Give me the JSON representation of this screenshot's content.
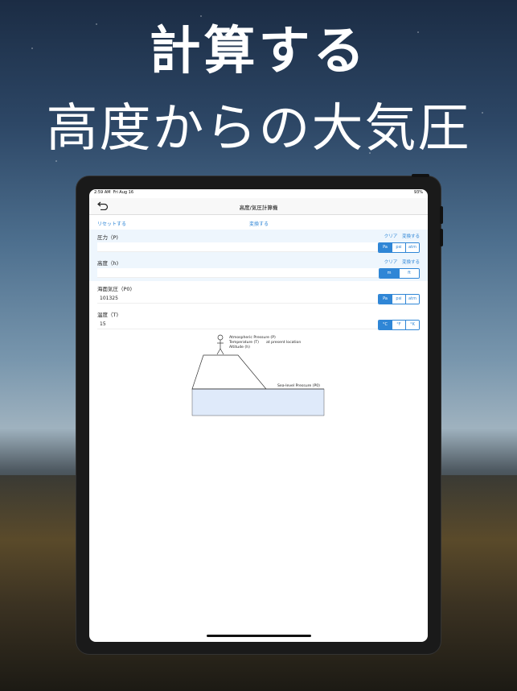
{
  "promo": {
    "line1": "計算する",
    "line2": "高度からの大気圧"
  },
  "status": {
    "time": "2:59 AM",
    "date": "Fri Aug 16",
    "battery": "93%"
  },
  "nav": {
    "title": "高度/気圧計算機",
    "back_icon": "undo-arrow-icon"
  },
  "toolbar": {
    "reset": "リセットする",
    "convert": "変換する"
  },
  "fields": [
    {
      "label": "圧力（P)",
      "value": "",
      "links": [
        "クリア",
        "変換する"
      ],
      "units": [
        "Pa",
        "psi",
        "atm"
      ],
      "selected": 0
    },
    {
      "label": "高度（h)",
      "value": "",
      "links": [
        "クリア",
        "変換する"
      ],
      "units": [
        "m",
        "ft"
      ],
      "selected": 0
    },
    {
      "label": "海面気圧（P0)",
      "value": "101325",
      "links": [],
      "units": [
        "Pa",
        "psi",
        "atm"
      ],
      "selected": 0
    },
    {
      "label": "温度（T)",
      "value": "15",
      "links": [],
      "units": [
        "°C",
        "°F",
        "°K"
      ],
      "selected": 0
    }
  ],
  "diagram": {
    "labels": {
      "atmospheric": "Atmospheric Pressure (P)",
      "temperature": "Temperature (T)",
      "at_location": "at present location",
      "altitude": "Altitude (h)",
      "sea_level": "Sea-level Pressure (P0)"
    }
  },
  "colors": {
    "accent": "#2f86d6",
    "water": "#dfeafa"
  }
}
